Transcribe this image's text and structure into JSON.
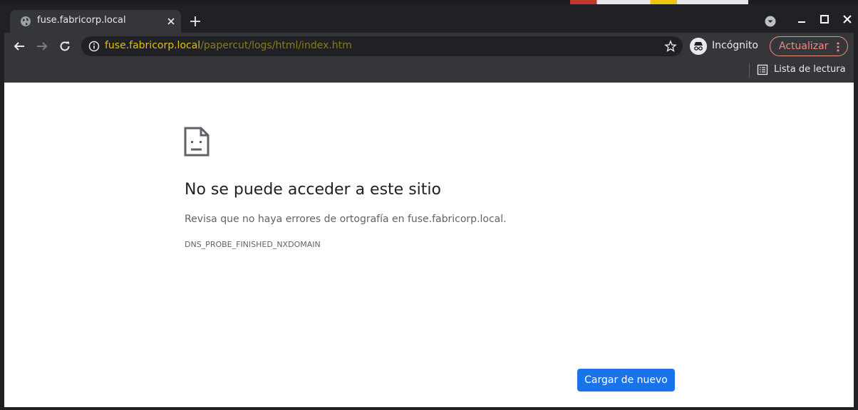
{
  "tab": {
    "title": "fuse.fabricorp.local",
    "favicon": "globe-icon"
  },
  "toolbar": {
    "url_host": "fuse.fabricorp.local",
    "url_path": "/papercut/logs/html/index.htm",
    "incognito_label": "Incógnito",
    "update_label": "Actualizar"
  },
  "bookmarks": {
    "reading_list_label": "Lista de lectura"
  },
  "error_page": {
    "title": "No se puede acceder a este sitio",
    "description": "Revisa que no haya errores de ortografía en fuse.fabricorp.local.",
    "error_code": "DNS_PROBE_FINISHED_NXDOMAIN",
    "reload_button_label": "Cargar de nuevo"
  },
  "colors": {
    "frame": "#202124",
    "toolbar": "#35363a",
    "url_host": "#e3c000",
    "url_path": "#8a7a1a",
    "update_accent": "#f28b82",
    "primary_button": "#1a73e8"
  }
}
